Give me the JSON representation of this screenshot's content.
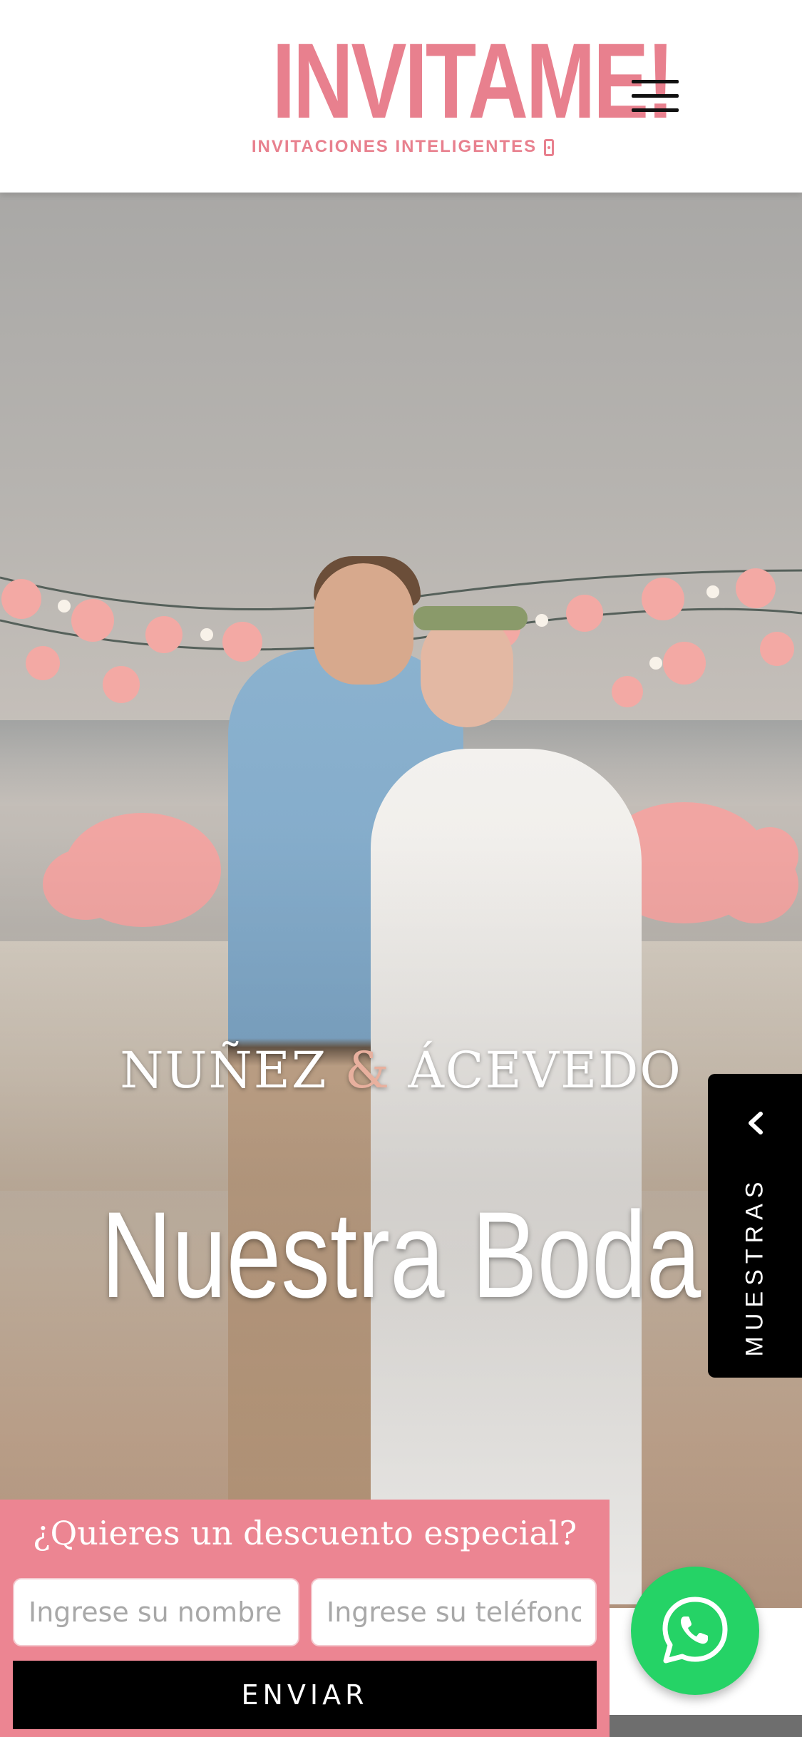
{
  "header": {
    "logo_title": "INVITAME!",
    "logo_subtitle": "INVITACIONES INTELIGENTES"
  },
  "hero": {
    "name_left": "NUÑEZ",
    "ampersand": "&",
    "name_right": "ÁCEVEDO",
    "title": "Nuestra Boda"
  },
  "side_tab": {
    "label": "MUESTRAS"
  },
  "discount_form": {
    "title": "¿Quieres un descuento especial?",
    "name_placeholder": "Ingrese su nombre",
    "phone_placeholder": "Ingrese su teléfono",
    "submit_label": "ENVIAR"
  },
  "icons": {
    "menu": "hamburger-menu-icon",
    "chevron": "chevron-left-icon",
    "whatsapp": "whatsapp-icon",
    "phone": "phone-heart-icon"
  },
  "colors": {
    "brand_pink": "#e8808e",
    "form_pink": "#ec8592",
    "whatsapp_green": "#25d366",
    "tab_black": "#000000"
  }
}
